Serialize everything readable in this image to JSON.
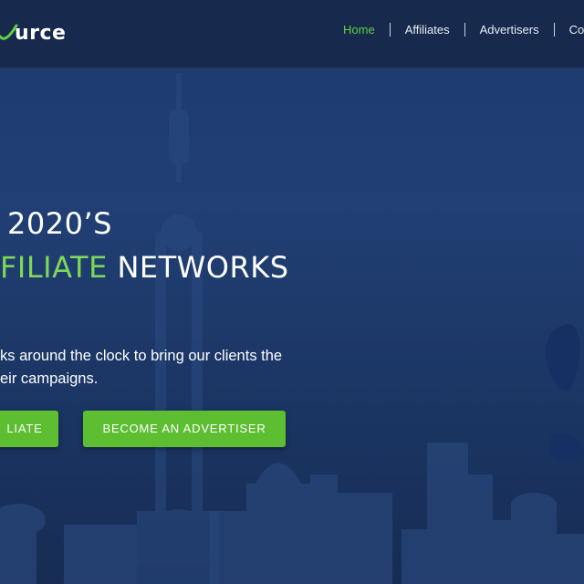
{
  "logo": {
    "text": "urce"
  },
  "nav": {
    "items": [
      {
        "label": "Home",
        "active": true
      },
      {
        "label": "Affiliates",
        "active": false
      },
      {
        "label": "Advertisers",
        "active": false
      },
      {
        "label": "Co",
        "active": false
      }
    ]
  },
  "hero": {
    "line1": "2020’S",
    "line2_accent": "FILIATE",
    "line2_rest": " NETWORKS",
    "description_line1": "ks around the clock to bring our clients the",
    "description_line2": "eir campaigns.",
    "button_affiliate": "LIATE",
    "button_advertiser": "BECOME AN ADVERTISER"
  },
  "colors": {
    "accent": "#5cbe30",
    "accent_text": "#7ed957",
    "nav_active": "#5fd142",
    "navbar_bg": "#17294d",
    "hero_bg": "#1c3a6e"
  }
}
